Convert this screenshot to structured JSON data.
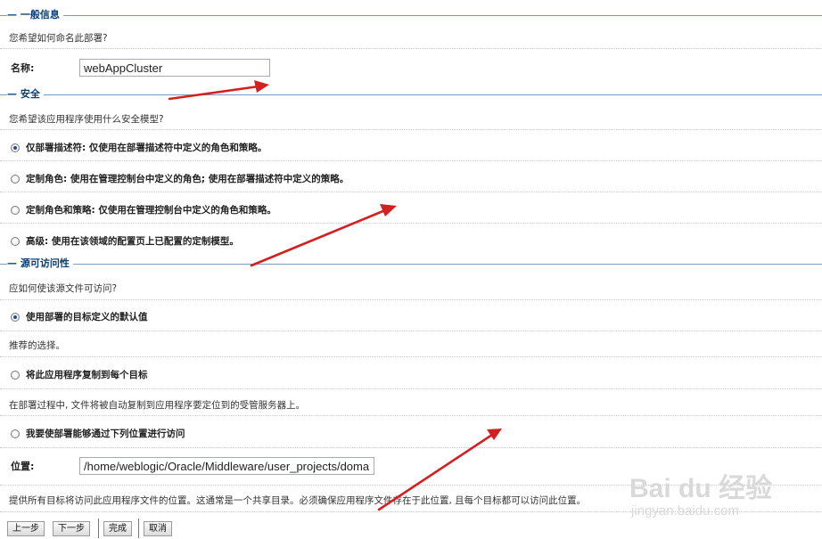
{
  "general": {
    "heading": "一般信息",
    "question": "您希望如何命名此部署?",
    "name_label": "名称:",
    "name_value": "webAppCluster"
  },
  "security": {
    "heading": "安全",
    "question": "您希望该应用程序使用什么安全模型?",
    "options": [
      {
        "label": "仅部署描述符: 仅使用在部署描述符中定义的角色和策略。",
        "selected": true
      },
      {
        "label": "定制角色: 使用在管理控制台中定义的角色; 使用在部署描述符中定义的策略。",
        "selected": false
      },
      {
        "label": "定制角色和策略: 仅使用在管理控制台中定义的角色和策略。",
        "selected": false
      },
      {
        "label": "高级: 使用在该领域的配置页上已配置的定制模型。",
        "selected": false
      }
    ]
  },
  "source": {
    "heading": "源可访问性",
    "question": "应如何使该源文件可访问?",
    "options": [
      {
        "label": "使用部署的目标定义的默认值",
        "selected": true,
        "note": "推荐的选择。"
      },
      {
        "label": "将此应用程序复制到每个目标",
        "selected": false,
        "note": "在部署过程中, 文件将被自动复制到应用程序要定位到的受管服务器上。"
      },
      {
        "label": "我要使部署能够通过下列位置进行访问",
        "selected": false
      }
    ],
    "location_label": "位置:",
    "location_value": "/home/weblogic/Oracle/Middleware/user_projects/domains",
    "footer_note": "提供所有目标将访问此应用程序文件的位置。这通常是一个共享目录。必须确保应用程序文件存在于此位置, 且每个目标都可以访问此位置。"
  },
  "buttons": {
    "back": "上一步",
    "next": "下一步",
    "finish": "完成",
    "cancel": "取消"
  },
  "watermark": {
    "brand": "Bai du 经验",
    "url": "jingyan.baidu.com"
  },
  "colors": {
    "heading": "#0b3f73",
    "rule": "#7e9cbc",
    "arrow": "#d42020",
    "radio_dot": "#1f4f9a"
  }
}
